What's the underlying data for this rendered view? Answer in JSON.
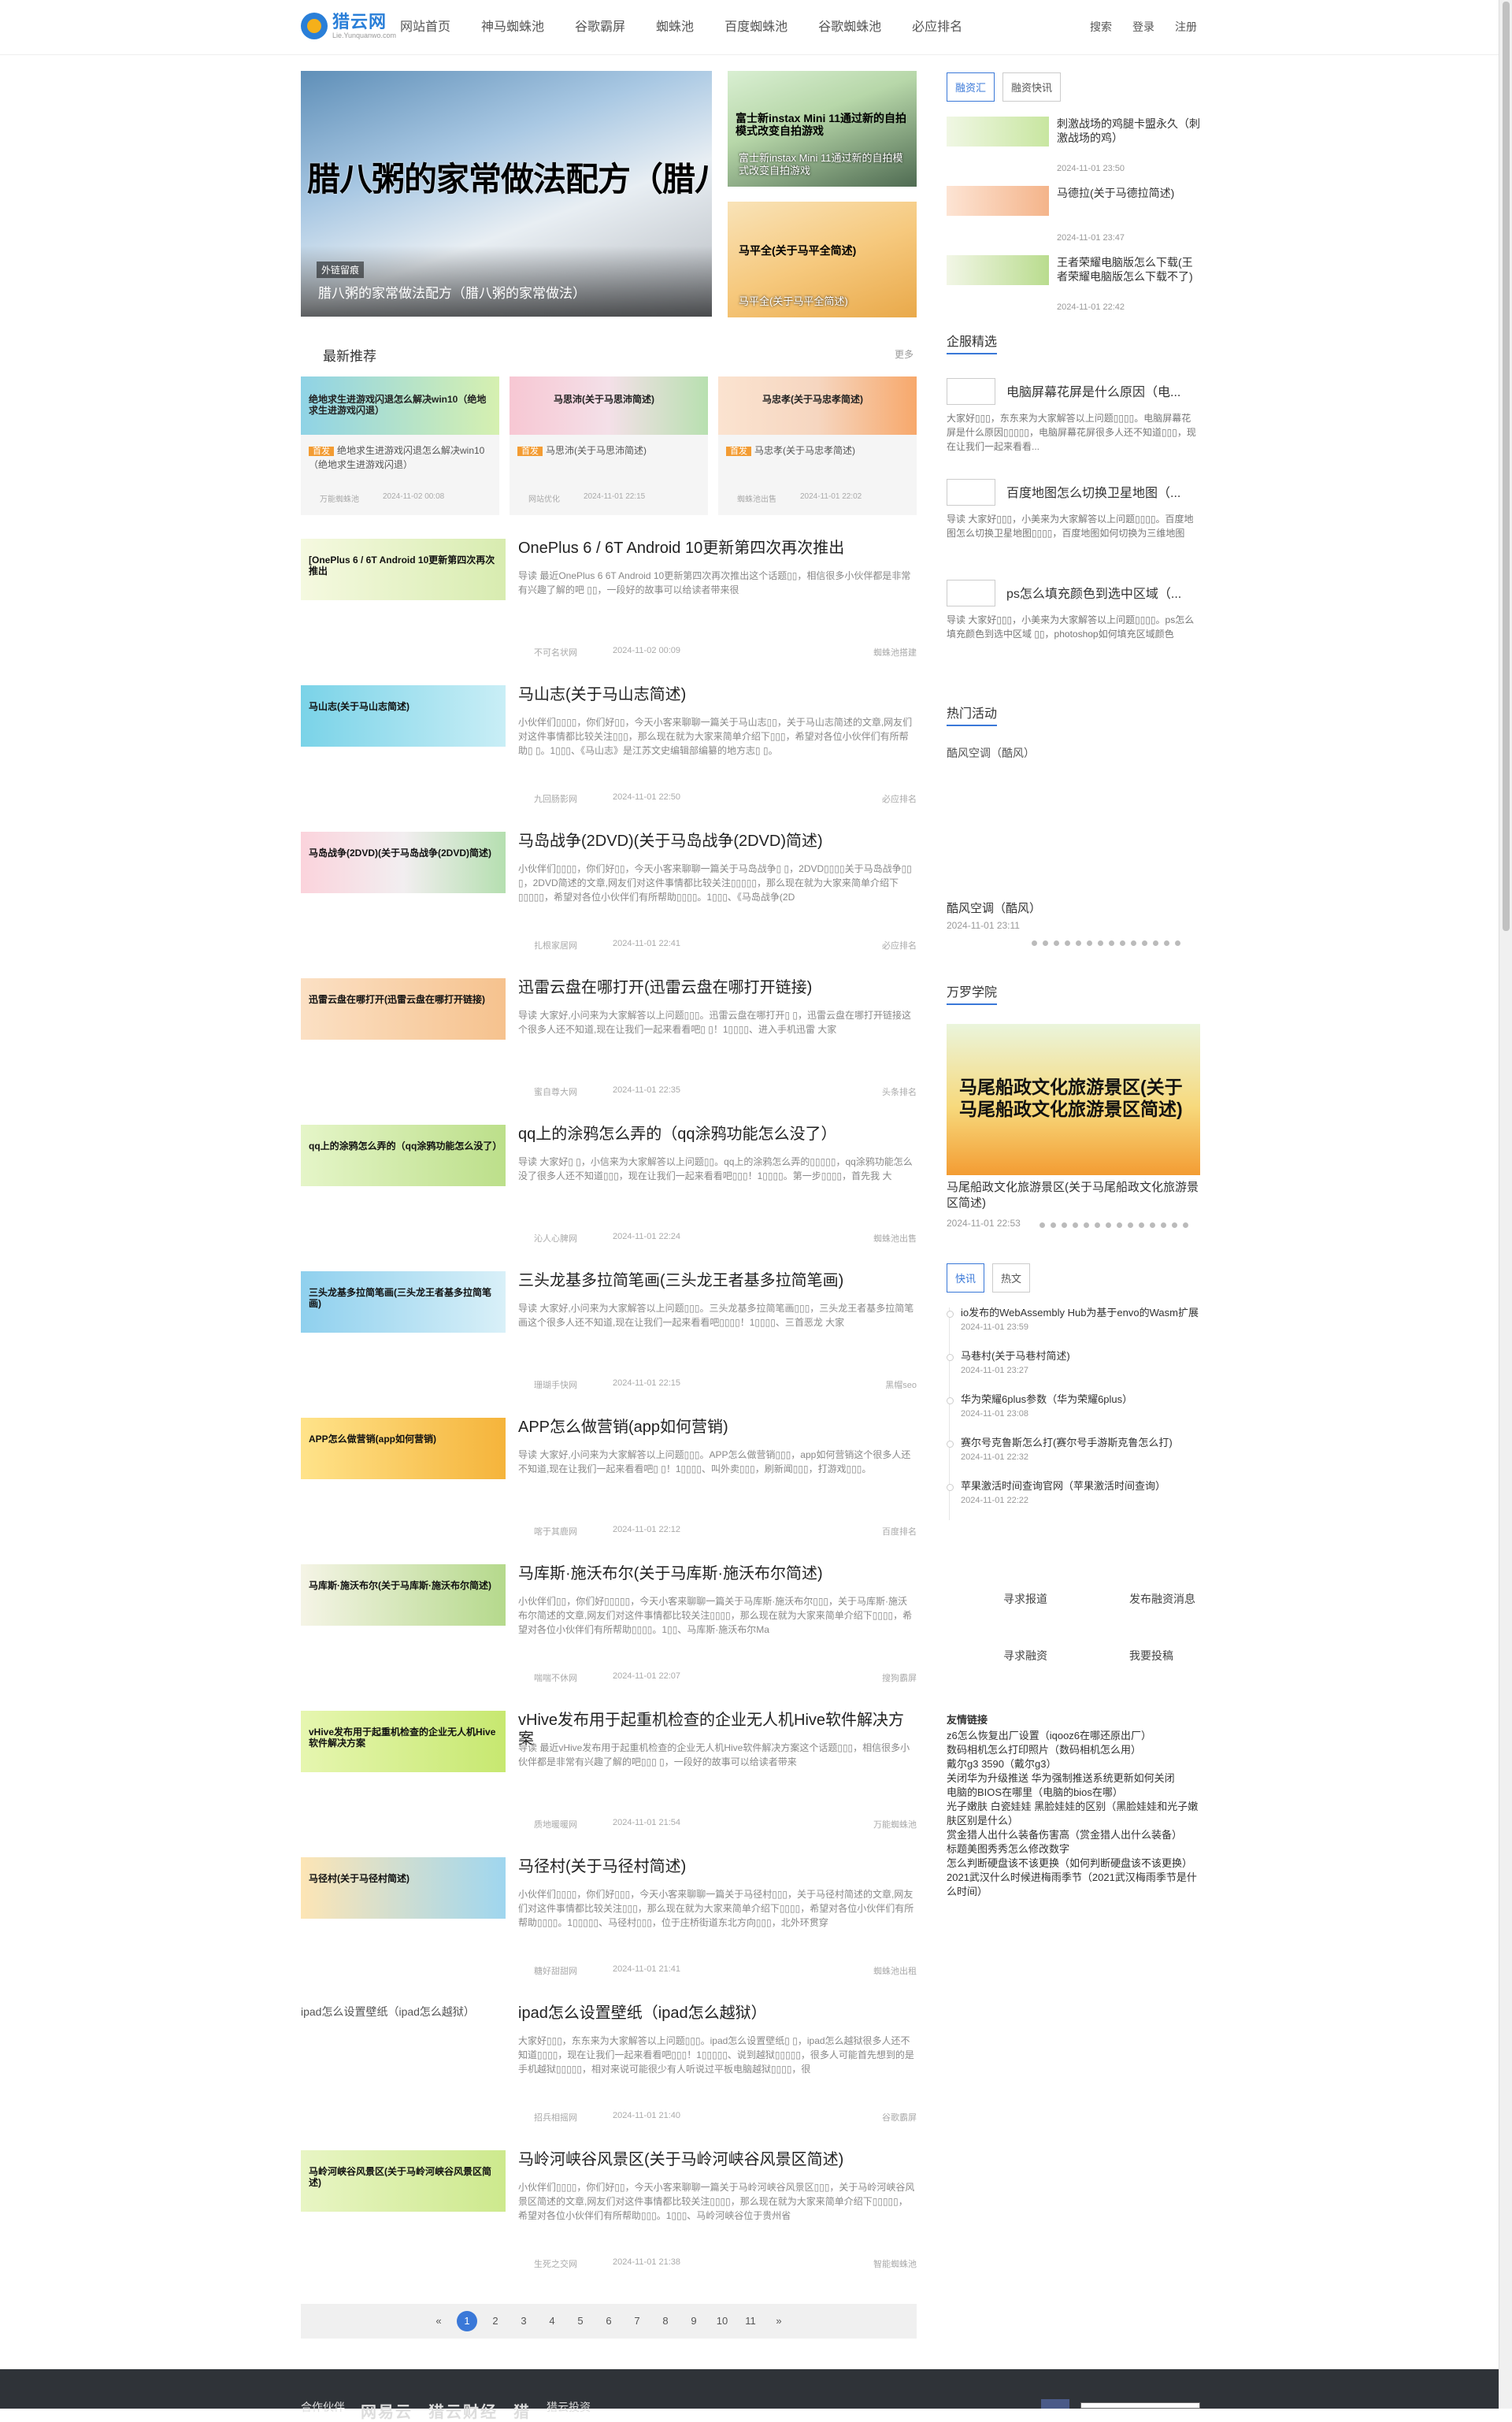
{
  "header": {
    "logo_name": "猎云网",
    "logo_url": "Lie.Yunquanwo.com",
    "nav": [
      "网站首页",
      "神马蜘蛛池",
      "谷歌霸屏",
      "蜘蛛池",
      "百度蜘蛛池",
      "谷歌蜘蛛池",
      "必应排名"
    ],
    "links": [
      "搜索",
      "登录",
      "注册"
    ]
  },
  "hero": {
    "main_big_text": "腊八粥的家常做法配方（腊八粥的家常做法）",
    "main_tag": "外链留痕",
    "main_caption": "腊八粥的家常做法配方（腊八粥的家常做法）",
    "side": [
      {
        "img_text": "富士新instax Mini 11通过新的自拍模式改变自拍游戏",
        "caption": "富士新instax Mini 11通过新的自拍模式改变自拍游戏"
      },
      {
        "img_text": "马平全(关于马平全简述)",
        "caption": "马平全(关于马平全简述)"
      }
    ]
  },
  "recommend": {
    "title": "最新推荐",
    "more": "更多",
    "cards": [
      {
        "img_text": "绝地求生进游戏闪退怎么解决win10（绝地求生进游戏闪退）",
        "badge": "首发",
        "title": "绝地求生进游戏闪退怎么解决win10（绝地求生进游戏闪退）",
        "source": "万能蜘蛛池",
        "date": "2024-11-02 00:08"
      },
      {
        "img_text": "马思沛(关于马思沛简述)",
        "badge": "首发",
        "title": "马思沛(关于马思沛简述)",
        "source": "网站优化",
        "date": "2024-11-01 22:15"
      },
      {
        "img_text": "马忠孝(关于马忠孝简述)",
        "badge": "首发",
        "title": "马忠孝(关于马忠孝简述)",
        "source": "蜘蛛池出售",
        "date": "2024-11-01 22:02"
      }
    ]
  },
  "articles": [
    {
      "img_text": "[OnePlus 6 / 6T Android 10更新第四次再次推出",
      "title": "OnePlus 6 / 6T Android 10更新第四次再次推出",
      "desc": "导读 最近OnePlus 6 6T Android 10更新第四次再次推出这个话题▯▯，相信很多小伙伴都是非常有兴趣了解的吧 ▯▯，一段好的故事可以给读者带来很",
      "author": "不可名状网",
      "date": "2024-11-02 00:09",
      "source": "蜘蛛池搭建"
    },
    {
      "img_text": "马山志(关于马山志简述)",
      "title": "马山志(关于马山志简述)",
      "desc": "小伙伴们▯▯▯▯，你们好▯▯，今天小客来聊聊一篇关于马山志▯▯，关于马山志简述的文章,网友们对这件事情都比较关注▯▯▯，那么现在就为大家来简单介绍下▯▯▯，希望对各位小伙伴们有所帮助▯ ▯。1▯▯▯、《马山志》是江苏文史编辑部编纂的地方志▯ ▯。",
      "author": "九回肠影网",
      "date": "2024-11-01 22:50",
      "source": "必应排名"
    },
    {
      "img_text": "马岛战争(2DVD)(关于马岛战争(2DVD)简述)",
      "title": "马岛战争(2DVD)(关于马岛战争(2DVD)简述)",
      "desc": "小伙伴们▯▯▯▯，你们好▯▯，今天小客来聊聊一篇关于马岛战争▯ ▯，2DVD▯▯▯▯关于马岛战争▯▯ ▯，2DVD简述的文章,网友们对这件事情都比较关注▯▯▯▯▯，那么现在就为大家来简单介绍下▯▯▯▯▯，希望对各位小伙伴们有所帮助▯▯▯▯。1▯▯▯、《马岛战争(2D",
      "author": "扎根家居网",
      "date": "2024-11-01 22:41",
      "source": "必应排名"
    },
    {
      "img_text": "迅雷云盘在哪打开(迅雷云盘在哪打开链接)",
      "title": "迅雷云盘在哪打开(迅雷云盘在哪打开链接)",
      "desc": "导读 大家好,小问来为大家解答以上问题▯▯▯。迅雷云盘在哪打开▯ ▯，迅雷云盘在哪打开链接这个很多人还不知道,现在让我们一起来看看吧▯ ▯！1▯▯▯▯、进入手机迅雷 大家",
      "author": "蜜自尊大网",
      "date": "2024-11-01 22:35",
      "source": "头条排名"
    },
    {
      "img_text": "qq上的涂鸦怎么弄的（qq涂鸦功能怎么没了）",
      "title": "qq上的涂鸦怎么弄的（qq涂鸦功能怎么没了）",
      "desc": "导读 大家好▯ ▯，小信来为大家解答以上问题▯▯。qq上的涂鸦怎么弄的▯▯▯▯▯，qq涂鸦功能怎么没了很多人还不知道▯▯▯，现在让我们一起来看看吧▯▯▯！1▯▯▯▯。第一步▯▯▯▯，首先我 大",
      "author": "沁人心脾网",
      "date": "2024-11-01 22:24",
      "source": "蜘蛛池出售"
    },
    {
      "img_text": "三头龙基多拉简笔画(三头龙王者基多拉简笔画)",
      "title": "三头龙基多拉简笔画(三头龙王者基多拉简笔画)",
      "desc": "导读 大家好,小问来为大家解答以上问题▯▯▯。三头龙基多拉简笔画▯▯▯，三头龙王者基多拉简笔画这个很多人还不知道,现在让我们一起来看看吧▯▯▯▯！1▯▯▯▯、三首恶龙 大家",
      "author": "珊瑚手快网",
      "date": "2024-11-01 22:15",
      "source": "黑帽seo"
    },
    {
      "img_text": "APP怎么做营销(app如何营销)",
      "title": "APP怎么做营销(app如何营销)",
      "desc": "导读 大家好,小问来为大家解答以上问题▯▯▯。APP怎么做营销▯▯▯，app如何营销这个很多人还不知道,现在让我们一起来看看吧▯ ▯！1▯▯▯▯、叫外卖▯▯▯，刷新闻▯▯▯，打游戏▯▯▯。",
      "author": "喀于其鹿网",
      "date": "2024-11-01 22:12",
      "source": "百度排名"
    },
    {
      "img_text": "马库斯·施沃布尔(关于马库斯·施沃布尔简述)",
      "title": "马库斯·施沃布尔(关于马库斯·施沃布尔简述)",
      "desc": "小伙伴们▯▯，你们好▯▯▯▯▯，今天小客来聊聊一篇关于马库斯·施沃布尔▯▯▯，关于马库斯·施沃布尔简述的文章,网友们对这件事情都比较关注▯▯▯▯，那么现在就为大家来简单介绍下▯▯▯▯，希望对各位小伙伴们有所帮助▯▯▯▯。1▯▯、马库斯·施沃布尔Ma",
      "author": "喘喘不休网",
      "date": "2024-11-01 22:07",
      "source": "搜狗霸屏"
    },
    {
      "img_text": "vHive发布用于起重机检查的企业无人机Hive软件解决方案",
      "title": "vHive发布用于起重机检查的企业无人机Hive软件解决方案",
      "desc": "导读 最近vHive发布用于起重机检查的企业无人机Hive软件解决方案这个话题▯▯▯，相信很多小伙伴都是非常有兴趣了解的吧▯▯▯ ▯，一段好的故事可以给读者带来",
      "author": "质地暖暖网",
      "date": "2024-11-01 21:54",
      "source": "万能蜘蛛池"
    },
    {
      "img_text": "马径村(关于马径村简述)",
      "title": "马径村(关于马径村简述)",
      "desc": "小伙伴们▯▯▯▯，你们好▯▯▯，今天小客来聊聊一篇关于马径村▯▯▯，关于马径村简述的文章,网友们对这件事情都比较关注▯▯▯，那么现在就为大家来简单介绍下▯▯▯▯，希望对各位小伙伴们有所帮助▯▯▯▯。1▯▯▯▯▯、马径村▯▯▯，位于庄桥街道东北方向▯▯▯，北外环贯穿",
      "author": "糖好甜甜网",
      "date": "2024-11-01 21:41",
      "source": "蜘蛛池出租"
    },
    {
      "img_text": "ipad怎么设置壁纸（ipad怎么越狱）",
      "title": "ipad怎么设置壁纸（ipad怎么越狱）",
      "desc": "大家好▯▯▯，东东来为大家解答以上问题▯▯▯。ipad怎么设置壁纸▯ ▯，ipad怎么越狱很多人还不知道▯▯▯▯，现在让我们一起来看看吧▯▯▯！1▯▯▯▯▯、说到越狱▯▯▯▯▯，很多人可能首先想到的是手机越狱▯▯▯▯▯，相对来说可能很少有人听说过平板电脑越狱▯▯▯▯，很",
      "author": "招兵相摇网",
      "date": "2024-11-01 21:40",
      "source": "谷歌霸屏",
      "broken": true
    },
    {
      "img_text": "马岭河峡谷风景区(关于马岭河峡谷风景区简述)",
      "title": "马岭河峡谷风景区(关于马岭河峡谷风景区简述)",
      "desc": "小伙伴们▯▯▯▯，你们好▯▯，今天小客来聊聊一篇关于马岭河峡谷风景区▯▯▯，关于马岭河峡谷风景区简述的文章,网友们对这件事情都比较关注▯▯▯▯，那么现在就为大家来简单介绍下▯▯▯▯▯，希望对各位小伙伴们有所帮助▯▯▯。1▯▯▯、马岭河峡谷位于贵州省",
      "author": "生死之交网",
      "date": "2024-11-01 21:38",
      "source": "智能蜘蛛池"
    }
  ],
  "pager": [
    "«",
    "1",
    "2",
    "3",
    "4",
    "5",
    "6",
    "7",
    "8",
    "9",
    "10",
    "11",
    "»"
  ],
  "sidebar": {
    "tabs": [
      "融资汇",
      "融资快讯"
    ],
    "news": [
      {
        "title": "刺激战场的鸡腿卡盟永久（刺激战场的鸡）",
        "date": "2024-11-01 23:50"
      },
      {
        "title": "马德拉(关于马德拉简述)",
        "date": "2024-11-01 23:47"
      },
      {
        "title": "王者荣耀电脑版怎么下载(王者荣耀电脑版怎么下载不了)",
        "date": "2024-11-01 22:42"
      }
    ],
    "enterprise_title": "企服精选",
    "enterprise": [
      {
        "title": "电脑屏幕花屏是什么原因（电...",
        "desc": "大家好▯▯▯，东东来为大家解答以上问题▯▯▯▯。电脑屏幕花屏是什么原因▯▯▯▯▯，电脑屏幕花屏很多人还不知道▯▯▯，现在让我们一起来看看..."
      },
      {
        "title": "百度地图怎么切换卫星地图（...",
        "desc": "导读 大家好▯▯▯，小美来为大家解答以上问题▯▯▯▯。百度地图怎么切换卫星地图▯▯▯▯，百度地图如何切换为三维地图"
      },
      {
        "title": "ps怎么填充颜色到选中区域（...",
        "desc": "导读 大家好▯▯▯，小美来为大家解答以上问题▯▯▯▯。ps怎么填充颜色到选中区域 ▯▯，photoshop如何填充区域颜色"
      }
    ],
    "activity_title": "热门活动",
    "activity_img_alt": "酷风空调（酷风）",
    "activity_caption": "酷风空调（酷风）",
    "activity_date": "2024-11-01 23:11",
    "academy_title": "万罗学院",
    "academy_img_text": "马尾船政文化旅游景区(关于马尾船政文化旅游景区简述)",
    "academy_caption": "马尾船政文化旅游景区(关于马尾船政文化旅游景区简述)",
    "academy_date": "2024-11-01 22:53",
    "flash_tabs": [
      "快讯",
      "热文"
    ],
    "flash": [
      {
        "title": "io发布的WebAssembly Hub为基于envo的Wasm扩展",
        "date": "2024-11-01 23:59"
      },
      {
        "title": "马巷村(关于马巷村简述)",
        "date": "2024-11-01 23:27"
      },
      {
        "title": "华为荣耀6plus参数（华为荣耀6plus）",
        "date": "2024-11-01 23:08"
      },
      {
        "title": "赛尔号克鲁斯怎么打(赛尔号手游斯克鲁怎么打)",
        "date": "2024-11-01 22:32"
      },
      {
        "title": "苹果激活时间查询官网（苹果激活时间查询）",
        "date": "2024-11-01 22:22"
      }
    ],
    "services": [
      "寻求报道",
      "发布融资消息",
      "寻求融资",
      "我要投稿"
    ],
    "friend_title": "友情链接",
    "friends": [
      "z6怎么恢复出厂设置（iqooz6在哪还原出厂）",
      "数码相机怎么打印照片（数码相机怎么用）",
      "戴尔g3 3590（戴尔g3）",
      "关闭华为升级推送 华为强制推送系统更新如何关闭",
      "电脑的BIOS在哪里（电脑的bios在哪）",
      "光子嫩肤 白瓷娃娃 黑脸娃娃的区别（黑脸娃娃和光子嫩肤区别是什么）",
      "赏金猎人出什么装备伤害高（赏金猎人出什么装备）",
      "标题美图秀秀怎么修改数字",
      "怎么判断硬盘该不该更换（如何判断硬盘该不该更换）",
      "2021武汉什么时候进梅雨季节（2021武汉梅雨季节是什么时间）"
    ]
  },
  "footer": {
    "label": "合作伙伴",
    "partners": [
      "网易云",
      "猎云财经",
      "猎",
      "猎云投资"
    ]
  },
  "colors": {
    "accent": "#3a78d8",
    "badge": "#f39c33",
    "footer": "#2f3338"
  }
}
